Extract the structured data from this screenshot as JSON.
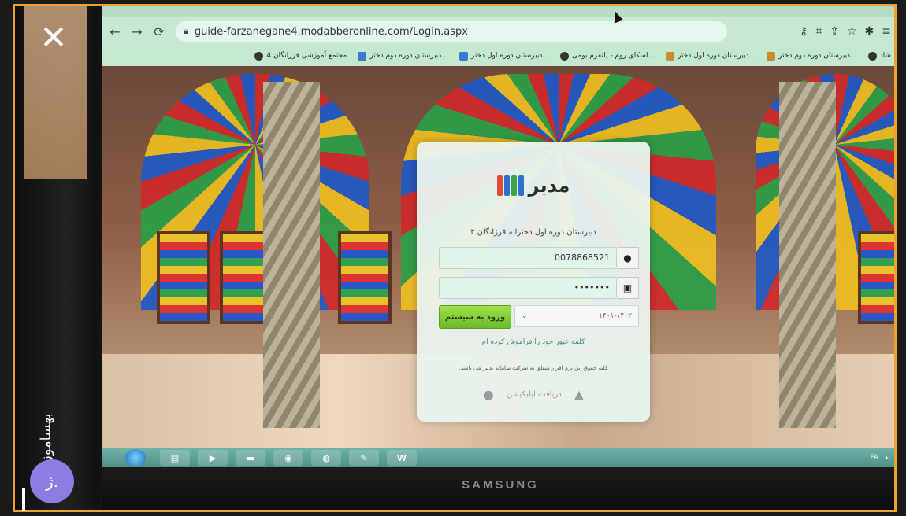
{
  "browser": {
    "url": "guide-farzanegane4.modabberonline.com/Login.aspx",
    "bookmarks": [
      "شاد",
      "دبیرستان دوره دوم دختر...",
      "دبیرستان دوره اول دختر...",
      "اسکای روم - پلتفرم بومی...",
      "دبیرستان دوره اول دختر...",
      "دبیرستان دوره دوم دختر...",
      "مجتمع آموزشی فرزانگان 4"
    ]
  },
  "login": {
    "app_name": "مدبر",
    "school_name": "دبیرستان دوره اول دخترانه فرزانگان ۴",
    "username": "0078868521",
    "password": "•••••••",
    "year": "۱۴۰۱-۱۴۰۲",
    "login_label": "ورود به سیستم",
    "forgot_label": "کلمه عبور خود را فراموش کرده ام",
    "copyright": "کلیه حقوق این نرم افزار متعلق به شرکت سامانه تدبیر می باشد.",
    "app_download": "دریافت اپلیکیشن"
  },
  "monitor": {
    "brand": "SAMSUNG"
  },
  "overlay": {
    "close": "✕",
    "watermark": "بهساموز",
    "avatar": "ژ."
  },
  "taskbar": {
    "tray_lang": "FA"
  },
  "colors": {
    "frame": "#f0a030",
    "login_button": "#8ed43e",
    "avatar": "#8e7ce0"
  }
}
